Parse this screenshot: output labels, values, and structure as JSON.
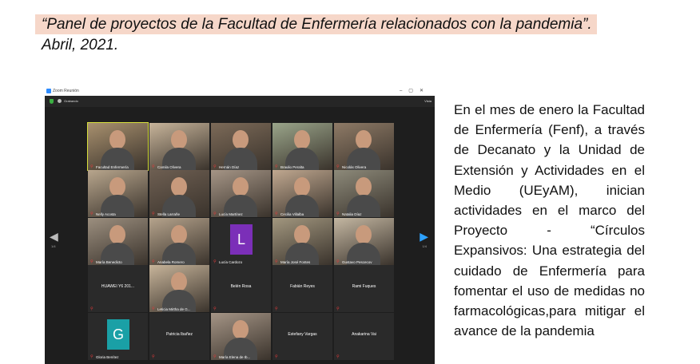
{
  "caption": {
    "title": "“Panel de proyectos de la Facultad de Enfermería relacionados con la pandemia”.",
    "date": "Abril, 2021."
  },
  "zoom": {
    "window_title": "Zoom Reunión",
    "recording": "Grabando",
    "view_label": "Vista",
    "nav_left_label": "1/4",
    "nav_right_label": "1/4",
    "participants": [
      {
        "name": "Facultad Enfermería",
        "type": "video",
        "active": true
      },
      {
        "name": "Camila Olivera",
        "type": "video"
      },
      {
        "name": "Hernán Díaz",
        "type": "video"
      },
      {
        "name": "Braulio Peralta",
        "type": "video"
      },
      {
        "name": "Nicolás Olivera",
        "type": "video"
      },
      {
        "name": "Nelly Acosta",
        "type": "video"
      },
      {
        "name": "Stella Larrañe",
        "type": "video"
      },
      {
        "name": "Lucía Martínez",
        "type": "video"
      },
      {
        "name": "Cecilia Villalba",
        "type": "video"
      },
      {
        "name": "Natalia Díaz",
        "type": "video"
      },
      {
        "name": "María Benedicto",
        "type": "video"
      },
      {
        "name": "Anabela Romero",
        "type": "video"
      },
      {
        "name": "Lucía Cardozo",
        "type": "letter",
        "letter": "L"
      },
      {
        "name": "María José Fontes",
        "type": "video"
      },
      {
        "name": "Gustavo Pescecov",
        "type": "video"
      },
      {
        "name": "HUAWEI Y6 201...",
        "type": "text"
      },
      {
        "name": "Leticia Mirtha de G...",
        "type": "video"
      },
      {
        "name": "Belén Rosa",
        "type": "text"
      },
      {
        "name": "Fabián Reyes",
        "type": "text"
      },
      {
        "name": "Rami Fuques",
        "type": "text"
      },
      {
        "name": "Gloria Benítez",
        "type": "letter",
        "letter": "G"
      },
      {
        "name": "Patricia Ibañez",
        "type": "text"
      },
      {
        "name": "María Elena de Ib...",
        "type": "video"
      },
      {
        "name": "Estefany Vargas",
        "type": "text"
      },
      {
        "name": "Anakarina Vai",
        "type": "text"
      }
    ]
  },
  "body_text": "En el mes de enero la Facultad de Enfermería (Fenf), a través de Decanato y la Unidad de Extensión y Actividades en el Medio (UEyAM), inician actividades en el marco del Proyecto - “Círculos Expansivos: Una estrategia del cuidado de Enfermería para fomentar el uso de medidas no farmacológicas,para mitigar el avance de la pandemia",
  "colors": {
    "highlight": "#f6d7c9",
    "zoom_bg": "#1e1e1e",
    "active_border": "#d7e03c",
    "letter_L": "#7b2fb8",
    "letter_G": "#1aa0a6",
    "muted_mic": "#e03a3a"
  }
}
